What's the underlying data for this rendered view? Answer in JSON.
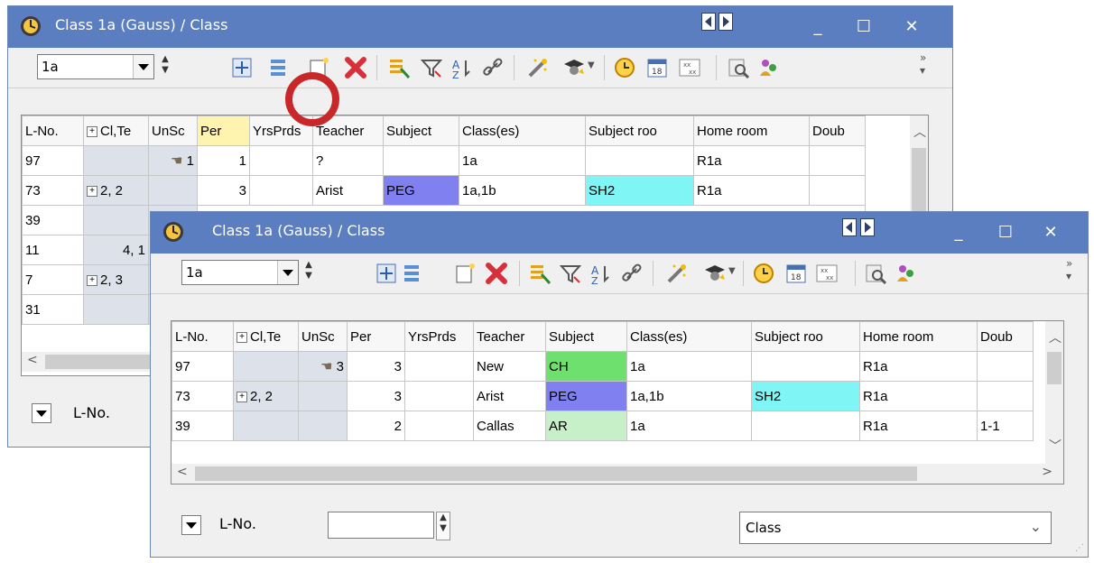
{
  "back_window": {
    "title": "Class 1a (Gauss) / Class",
    "class_value": "1a",
    "columns": [
      "L-No.",
      "Cl,Te",
      "UnSc",
      "Per",
      "YrsPrds",
      "Teacher",
      "Subject",
      "Class(es)",
      "Subject roo",
      "Home room",
      "Doub"
    ],
    "rows": [
      {
        "lno": "97",
        "clte": "",
        "unsc": "1",
        "per": "1",
        "yrs": "",
        "teacher": "?",
        "subject": "",
        "classes": "1a",
        "subroom": "",
        "homeroom": "R1a",
        "doub": ""
      },
      {
        "lno": "73",
        "clte": "2, 2",
        "unsc": "",
        "per": "3",
        "yrs": "",
        "teacher": "Arist",
        "subject": "PEG",
        "classes": "1a,1b",
        "subroom": "SH2",
        "homeroom": "R1a",
        "doub": ""
      },
      {
        "lno": "39"
      },
      {
        "lno": "11",
        "clte": "4, 1"
      },
      {
        "lno": "7",
        "clte": "2, 3"
      },
      {
        "lno": "31"
      }
    ],
    "bottom_label": "L-No."
  },
  "front_window": {
    "title": "Class 1a (Gauss) / Class",
    "class_value": "1a",
    "columns": [
      "L-No.",
      "Cl,Te",
      "UnSc",
      "Per",
      "YrsPrds",
      "Teacher",
      "Subject",
      "Class(es)",
      "Subject roo",
      "Home room",
      "Doub"
    ],
    "rows": [
      {
        "lno": "97",
        "clte": "",
        "unsc": "3",
        "per": "3",
        "yrs": "",
        "teacher": "New",
        "subject": "CH",
        "classes": "1a",
        "subroom": "",
        "homeroom": "R1a",
        "doub": ""
      },
      {
        "lno": "73",
        "clte": "2, 2",
        "unsc": "",
        "per": "3",
        "yrs": "",
        "teacher": "Arist",
        "subject": "PEG",
        "classes": "1a,1b",
        "subroom": "SH2",
        "homeroom": "R1a",
        "doub": ""
      },
      {
        "lno": "39",
        "clte": "",
        "unsc": "",
        "per": "2",
        "yrs": "",
        "teacher": "Callas",
        "subject": "AR",
        "classes": "1a",
        "subroom": "",
        "homeroom": "R1a",
        "doub": "1-1"
      }
    ],
    "bottom_label": "L-No.",
    "view_select": "Class"
  },
  "colors": {
    "titlebar": "#5b7ec0",
    "subject_ch": "#6ee06e",
    "subject_peg": "#8080f0",
    "subject_ar": "#c8f0c8",
    "room_sh2": "#7ff5f5",
    "highlight_circle": "#c8282a"
  },
  "icons": [
    "clock-icon",
    "nav-left-icon",
    "nav-right-icon",
    "minimize-icon",
    "maximize-icon",
    "close-icon",
    "expand-grid-icon",
    "list-icon",
    "new-lesson-icon",
    "delete-icon",
    "filter-list-icon",
    "filter-icon",
    "sort-icon",
    "link-icon",
    "magic-wand-icon",
    "teacher-icon",
    "timer-icon",
    "calendar-icon",
    "grid-xx-icon",
    "zoom-icon",
    "users-icon"
  ]
}
